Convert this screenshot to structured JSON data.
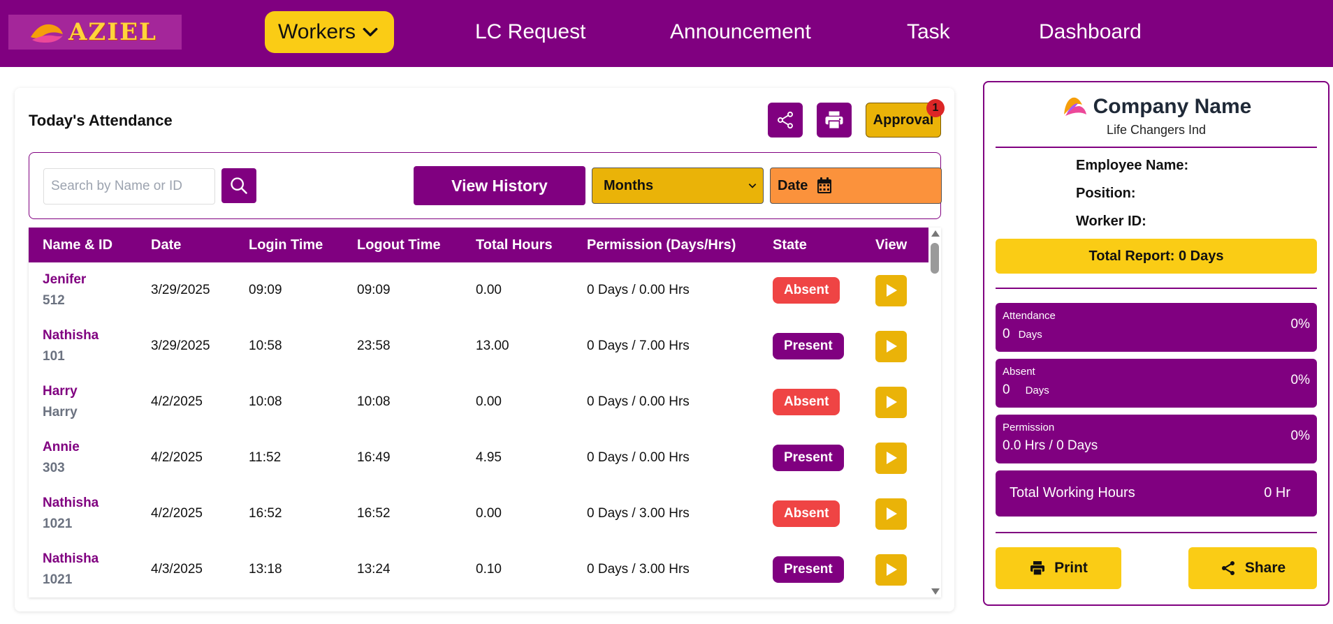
{
  "brand": {
    "logo_text": "AZIEL"
  },
  "nav": {
    "items": [
      {
        "label": "Workers"
      },
      {
        "label": "LC Request"
      },
      {
        "label": "Announcement"
      },
      {
        "label": "Task"
      },
      {
        "label": "Dashboard"
      }
    ]
  },
  "main": {
    "title": "Today's Attendance",
    "approval": {
      "label": "Approval",
      "badge": "1"
    },
    "search": {
      "placeholder": "Search by Name or ID"
    },
    "view_history_label": "View History",
    "months_label": "Months",
    "date_label": "Date",
    "table": {
      "headers": [
        "Name & ID",
        "Date",
        "Login Time",
        "Logout Time",
        "Total Hours",
        "Permission (Days/Hrs)",
        "State",
        "View"
      ],
      "rows": [
        {
          "name": "Jenifer",
          "id": "512",
          "date": "3/29/2025",
          "login": "09:09",
          "logout": "09:09",
          "hours": "0.00",
          "permission": "0 Days / 0.00 Hrs",
          "state": "Absent"
        },
        {
          "name": "Nathisha",
          "id": "101",
          "date": "3/29/2025",
          "login": "10:58",
          "logout": "23:58",
          "hours": "13.00",
          "permission": "0 Days / 7.00 Hrs",
          "state": "Present"
        },
        {
          "name": "Harry",
          "id": "Harry",
          "date": "4/2/2025",
          "login": "10:08",
          "logout": "10:08",
          "hours": "0.00",
          "permission": "0 Days / 0.00 Hrs",
          "state": "Absent"
        },
        {
          "name": "Annie",
          "id": "303",
          "date": "4/2/2025",
          "login": "11:52",
          "logout": "16:49",
          "hours": "4.95",
          "permission": "0 Days / 0.00 Hrs",
          "state": "Present"
        },
        {
          "name": "Nathisha",
          "id": "1021",
          "date": "4/2/2025",
          "login": "16:52",
          "logout": "16:52",
          "hours": "0.00",
          "permission": "0 Days / 3.00 Hrs",
          "state": "Absent"
        },
        {
          "name": "Nathisha",
          "id": "1021",
          "date": "4/3/2025",
          "login": "13:18",
          "logout": "13:24",
          "hours": "0.10",
          "permission": "0 Days / 3.00 Hrs",
          "state": "Present"
        }
      ]
    }
  },
  "side": {
    "company_name": "Company Name",
    "company_sub": "Life Changers Ind",
    "employee_name_label": "Employee Name:",
    "position_label": "Position:",
    "worker_id_label": "Worker ID:",
    "total_report": "Total Report: 0 Days",
    "attendance": {
      "label": "Attendance",
      "value": "0",
      "unit": "Days",
      "pct": "0%"
    },
    "absent": {
      "label": "Absent",
      "value": "0",
      "unit": "Days",
      "pct": "0%"
    },
    "permission": {
      "label": "Permission",
      "value": "0.0 Hrs / 0 Days",
      "pct": "0%"
    },
    "total_working_hours": {
      "label": "Total Working Hours",
      "value": "0 Hr"
    },
    "print_label": "Print",
    "share_label": "Share"
  },
  "colors": {
    "primary": "#800080",
    "accent": "#facc15",
    "absent": "#ef4444",
    "date": "#fb923c",
    "months": "#eab308"
  },
  "icons": [
    "chevron-down-icon",
    "share-icon",
    "printer-icon",
    "search-icon",
    "calendar-icon",
    "play-icon"
  ]
}
